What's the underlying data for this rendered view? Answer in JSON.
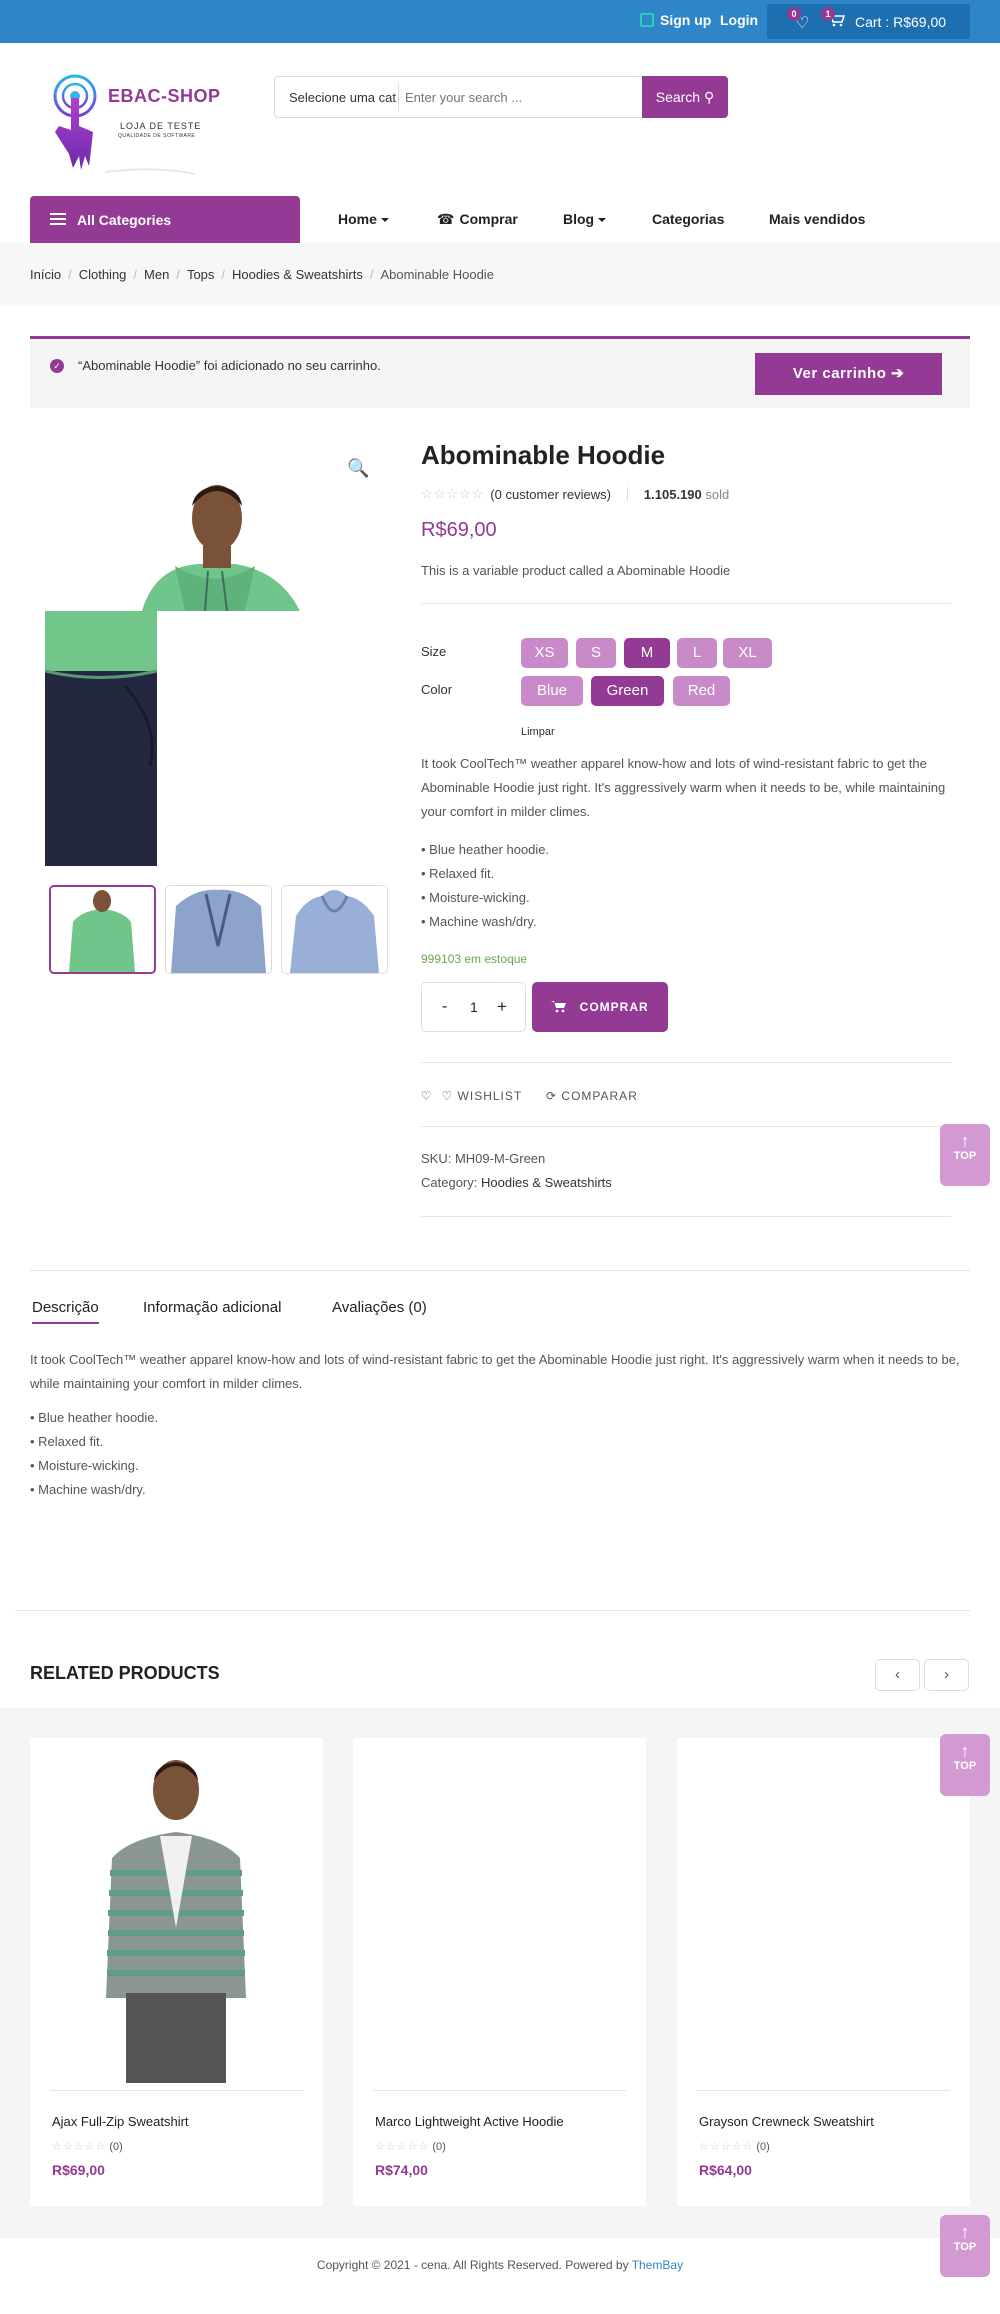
{
  "topbar": {
    "signup": "Sign up",
    "login": "Login",
    "wishlist_count": "0",
    "cart_count": "1",
    "cart_total": "Cart : R$69,00"
  },
  "logo": {
    "title": "EBAC-SHOP",
    "subtitle": "LOJA DE TESTE",
    "tagline": "QUALIDADE DE SOFTWARE"
  },
  "search": {
    "category": "Selecione uma cat",
    "placeholder": "Enter your search ...",
    "button": "Search"
  },
  "nav": {
    "all_categories": "All Categories",
    "items": [
      "Home",
      "Comprar",
      "Blog",
      "Categorias",
      "Mais vendidos"
    ]
  },
  "breadcrumb": [
    "Início",
    "Clothing",
    "Men",
    "Tops",
    "Hoodies & Sweatshirts",
    "Abominable Hoodie"
  ],
  "notice": {
    "text": "“Abominable Hoodie” foi adicionado no seu carrinho.",
    "button": "Ver carrinho"
  },
  "product": {
    "title": "Abominable Hoodie",
    "reviews": "(0 customer reviews)",
    "sold_count": "1.105.190",
    "sold_label": "sold",
    "price": "R$69,00",
    "short_description": "This is a variable product called a Abominable Hoodie",
    "size_label": "Size",
    "sizes": [
      "XS",
      "S",
      "M",
      "L",
      "XL"
    ],
    "selected_size": "M",
    "color_label": "Color",
    "colors": [
      "Blue",
      "Green",
      "Red"
    ],
    "selected_color": "Green",
    "clear": "Limpar",
    "description": "It took CoolTech™ weather apparel know-how and lots of wind-resistant fabric to get the Abominable Hoodie just right. It's aggressively warm when it needs to be, while maintaining your comfort in milder climes.",
    "bullets": [
      "• Blue heather hoodie.",
      "• Relaxed fit.",
      "• Moisture-wicking.",
      "• Machine wash/dry."
    ],
    "stock": "999103 em estoque",
    "quantity": "1",
    "qty_minus": "-",
    "qty_plus": "+",
    "buy_button": "COMPRAR",
    "wishlist": "WISHLIST",
    "compare": "COMPARAR",
    "sku_label": "SKU:",
    "sku": "MH09-M-Green",
    "category_label": "Category:",
    "category": "Hoodies & Sweatshirts"
  },
  "totop": {
    "label": "TOP"
  },
  "tabs": {
    "items": [
      "Descrição",
      "Informação adicional",
      "Avaliações (0)"
    ],
    "active": "Descrição"
  },
  "related": {
    "title": "RELATED PRODUCTS",
    "products": [
      {
        "name": "Ajax Full-Zip Sweatshirt",
        "reviews": "(0)",
        "price": "R$69,00"
      },
      {
        "name": "Marco Lightweight Active Hoodie",
        "reviews": "(0)",
        "price": "R$74,00"
      },
      {
        "name": "Grayson Crewneck Sweatshirt",
        "reviews": "(0)",
        "price": "R$64,00"
      }
    ]
  },
  "footer": {
    "copyright": "Copyright © 2021 - cena. All Rights Reserved. Powered by",
    "powered_by": "ThemBay"
  },
  "colors": {
    "accent": "#933a94",
    "accent_light": "#c98ac9",
    "topbar": "#2e86c9",
    "stock": "#6aa84f"
  }
}
